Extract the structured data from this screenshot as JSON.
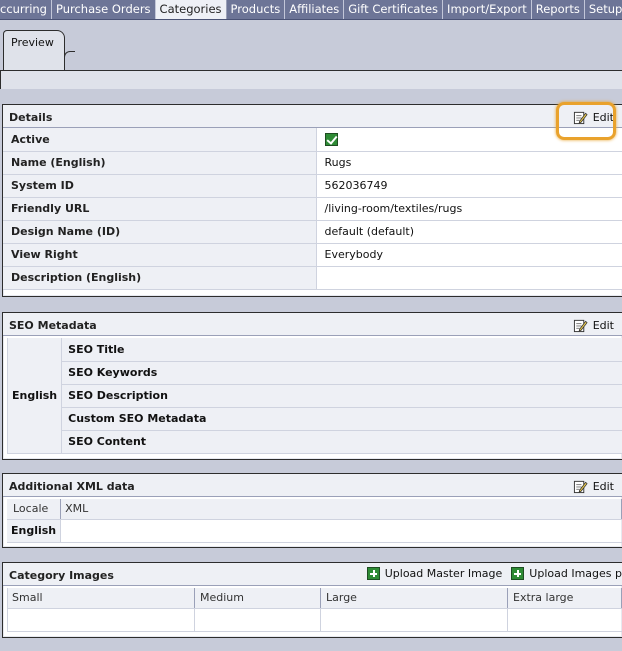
{
  "nav": {
    "tabs": [
      "ccurring",
      "Purchase Orders",
      "Categories",
      "Products",
      "Affiliates",
      "Gift Certificates",
      "Import/Export",
      "Reports",
      "Setup"
    ],
    "active": "Categories"
  },
  "subtabs": {
    "preview": "Preview"
  },
  "details": {
    "title": "Details",
    "edit_label": "Edit",
    "rows": [
      {
        "label": "Active",
        "value": ""
      },
      {
        "label": "Name (English)",
        "value": "Rugs"
      },
      {
        "label": "System ID",
        "value": "562036749"
      },
      {
        "label": "Friendly URL",
        "value": "/living-room/textiles/rugs"
      },
      {
        "label": "Design Name (ID)",
        "value": "default (default)"
      },
      {
        "label": "View Right",
        "value": "Everybody"
      },
      {
        "label": "Description (English)",
        "value": ""
      }
    ]
  },
  "seo": {
    "title": "SEO Metadata",
    "edit_label": "Edit",
    "locale": "English",
    "fields": [
      "SEO Title",
      "SEO Keywords",
      "SEO Description",
      "Custom SEO Metadata",
      "SEO Content"
    ]
  },
  "xml": {
    "title": "Additional XML data",
    "edit_label": "Edit",
    "col_locale": "Locale",
    "col_xml": "XML",
    "locale": "English"
  },
  "images": {
    "title": "Category Images",
    "upload_master": "Upload Master Image",
    "upload_images": "Upload Images p",
    "columns": [
      "Small",
      "Medium",
      "Large",
      "Extra large"
    ]
  },
  "icons": {
    "edit": "edit-pencil-icon",
    "active": "checkbox-checked-icon",
    "upload": "green-plus-icon"
  },
  "colors": {
    "nav_bg": "#6d7597",
    "page_bg": "#c7cbd9",
    "highlight": "#e9a22c",
    "check_green": "#2e8b35"
  }
}
